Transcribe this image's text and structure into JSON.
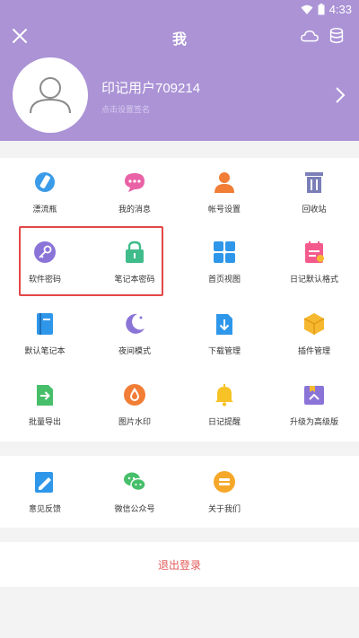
{
  "status": {
    "time": "4:33"
  },
  "topbar": {
    "title": "我"
  },
  "profile": {
    "username": "印记用户709214",
    "signature_hint": "点击设置签名"
  },
  "grid": {
    "row1": [
      {
        "label": "漂流瓶",
        "icon": "bottle-icon",
        "color": "#3a9be8"
      },
      {
        "label": "我的消息",
        "icon": "message-icon",
        "color": "#e962a6"
      },
      {
        "label": "帐号设置",
        "icon": "user-settings-icon",
        "color": "#f27d35"
      },
      {
        "label": "回收站",
        "icon": "trash-icon",
        "color": "#7b7fb7"
      }
    ],
    "row2": [
      {
        "label": "软件密码",
        "icon": "key-icon",
        "color": "#8b74d8"
      },
      {
        "label": "笔记本密码",
        "icon": "lock-icon",
        "color": "#3fbc8a"
      },
      {
        "label": "首页视图",
        "icon": "grid-view-icon",
        "color": "#2f97ea"
      },
      {
        "label": "日记默认格式",
        "icon": "calendar-format-icon",
        "color": "#f45b8d"
      }
    ],
    "row3": [
      {
        "label": "默认笔记本",
        "icon": "notebook-icon",
        "color": "#2f97ea"
      },
      {
        "label": "夜间模式",
        "icon": "moon-icon",
        "color": "#8b74d8"
      },
      {
        "label": "下载管理",
        "icon": "download-icon",
        "color": "#2f97ea"
      },
      {
        "label": "插件管理",
        "icon": "plugin-box-icon",
        "color": "#f6b830"
      }
    ],
    "row4": [
      {
        "label": "批量导出",
        "icon": "export-icon",
        "color": "#47bf6a"
      },
      {
        "label": "图片水印",
        "icon": "watermark-icon",
        "color": "#f27d35"
      },
      {
        "label": "日记提醒",
        "icon": "bell-icon",
        "color": "#f6c226"
      },
      {
        "label": "升级为高级版",
        "icon": "upgrade-icon",
        "color": "#8b74d8"
      }
    ],
    "row5": [
      {
        "label": "意见反馈",
        "icon": "feedback-icon",
        "color": "#2f97ea"
      },
      {
        "label": "微信公众号",
        "icon": "wechat-icon",
        "color": "#47bf6a"
      },
      {
        "label": "关于我们",
        "icon": "about-icon",
        "color": "#f6a82a"
      }
    ]
  },
  "logout": {
    "label": "退出登录"
  },
  "colors": {
    "header": "#ab93d6",
    "highlight": "#e34747",
    "logout": "#e35a5a"
  }
}
